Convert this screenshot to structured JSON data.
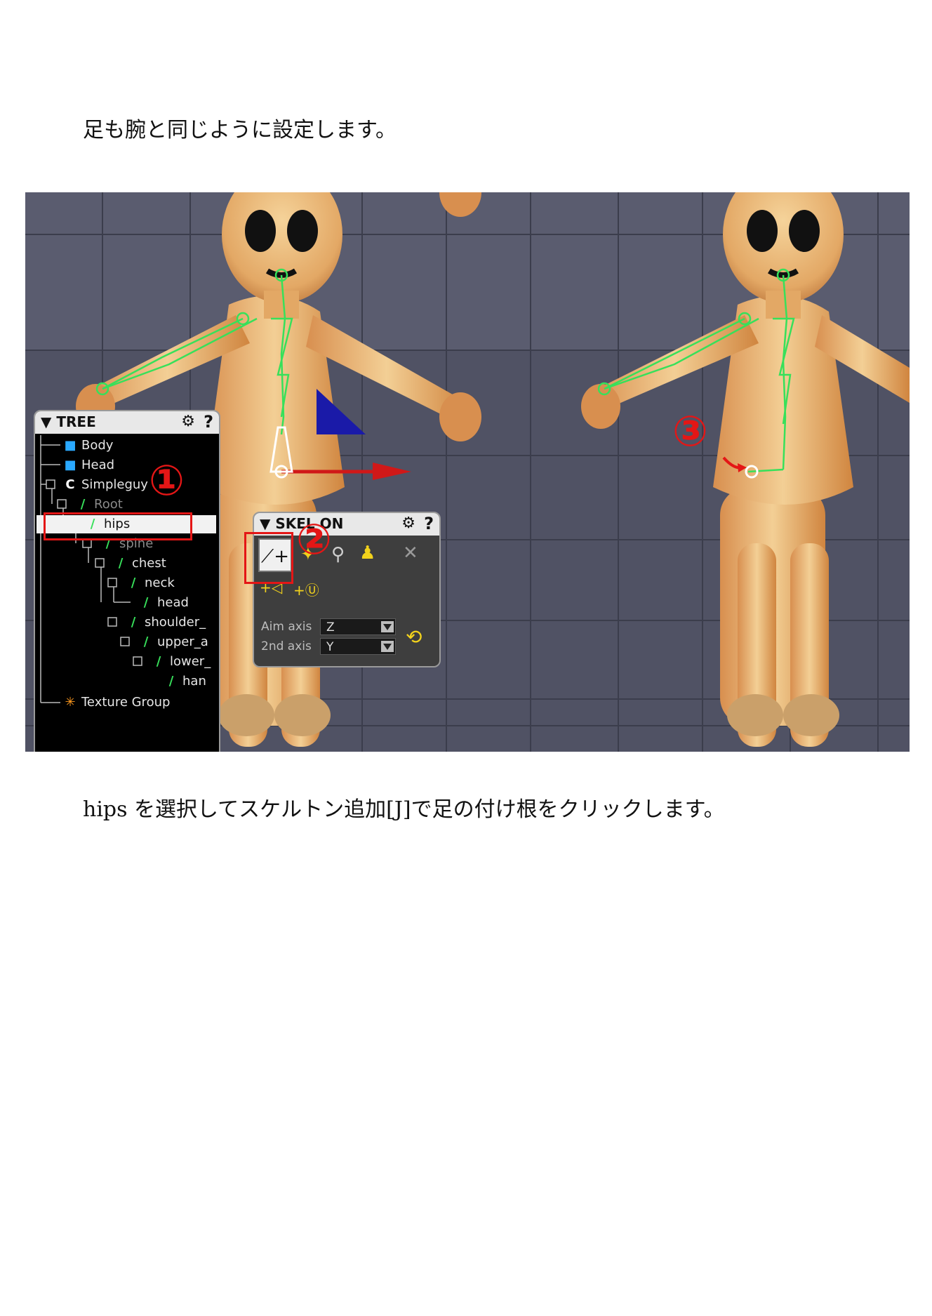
{
  "document": {
    "intro_text": "足も腕と同じように設定します。",
    "instruction_text": "hips を選択してスケルトン追加[J]で足の付け根をクリックします。"
  },
  "tree_panel": {
    "title": "TREE",
    "gear_icon": "gear-icon",
    "help_label": "?",
    "items": [
      {
        "label": "Body",
        "icon": "mesh-icon"
      },
      {
        "label": "Head",
        "icon": "mesh-icon"
      },
      {
        "label": "Simpleguy",
        "icon": "group-icon"
      },
      {
        "label": "Root",
        "icon": "bone-icon"
      },
      {
        "label": "hips",
        "icon": "bone-icon",
        "selected": true
      },
      {
        "label": "spine",
        "icon": "bone-icon"
      },
      {
        "label": "chest",
        "icon": "bone-icon"
      },
      {
        "label": "neck",
        "icon": "bone-icon"
      },
      {
        "label": "head",
        "icon": "bone-icon"
      },
      {
        "label": "shoulder_",
        "icon": "bone-icon"
      },
      {
        "label": "upper_a",
        "icon": "bone-icon"
      },
      {
        "label": "lower_",
        "icon": "bone-icon"
      },
      {
        "label": "han",
        "icon": "bone-icon"
      },
      {
        "label": "Texture Group",
        "icon": "texture-group-icon"
      }
    ]
  },
  "skeleton_panel": {
    "title": "SKEL    ON",
    "help_label": "?",
    "aim_axis_label": "Aim axis",
    "aim_axis_value": "Z",
    "second_axis_label": "2nd axis",
    "second_axis_value": "Y"
  },
  "annotations": {
    "step1": "①",
    "step2": "②",
    "step3": "③"
  },
  "colors": {
    "annotation_red": "#e41616",
    "bone_green": "#37e05a",
    "viewport_bg": "#505264"
  }
}
